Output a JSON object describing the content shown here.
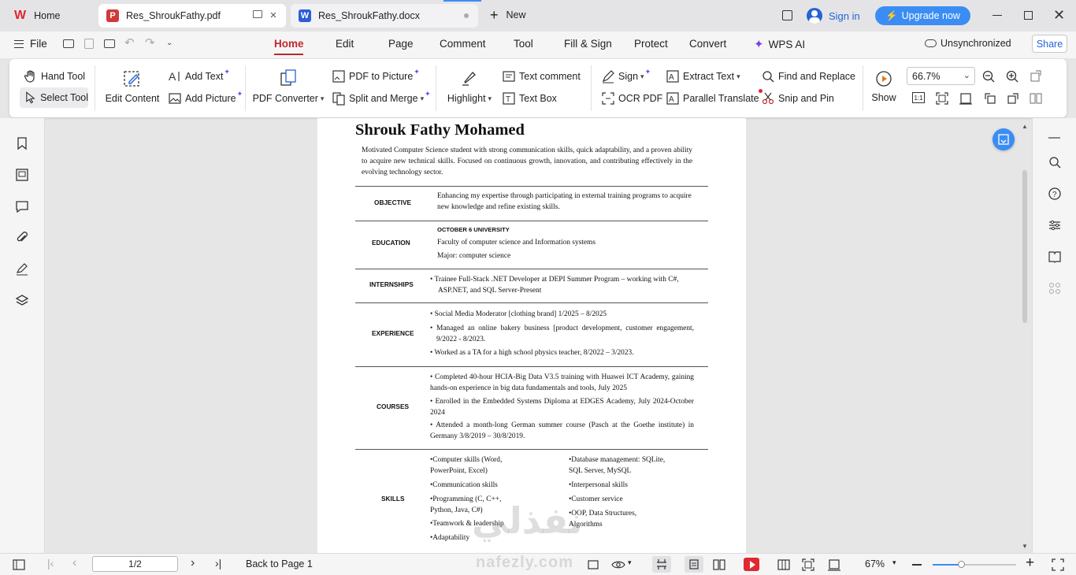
{
  "tabs": [
    {
      "label": "Home",
      "icon": "wps-logo-icon"
    },
    {
      "label": "Res_ShroukFathy.pdf",
      "icon": "pdf-icon"
    },
    {
      "label": "Res_ShroukFathy.docx",
      "icon": "word-icon"
    }
  ],
  "new_tab_label": "New",
  "sign_in_label": "Sign in",
  "upgrade_label": "Upgrade now",
  "menu": {
    "file": "File",
    "tabs": [
      "Home",
      "Edit",
      "Page",
      "Comment",
      "Tool",
      "Fill & Sign",
      "Protect",
      "Convert",
      "WPS AI"
    ],
    "active_tab": "Home",
    "sync_status": "Unsynchronized",
    "share": "Share"
  },
  "ribbon": {
    "hand_tool": "Hand Tool",
    "select_tool": "Select Tool",
    "edit_content": "Edit Content",
    "add_text": "Add Text",
    "add_picture": "Add Picture",
    "pdf_converter": "PDF Converter",
    "pdf_to_picture": "PDF to Picture",
    "split_and_merge": "Split and Merge",
    "highlight": "Highlight",
    "text_comment": "Text comment",
    "text_box": "Text Box",
    "sign": "Sign",
    "ocr_pdf": "OCR PDF",
    "extract_text": "Extract Text",
    "parallel_translate": "Parallel Translate",
    "find_and_replace": "Find and Replace",
    "snip_and_pin": "Snip and Pin",
    "show": "Show",
    "zoom_value": "66.7%",
    "actual_size": "1:1"
  },
  "document": {
    "name": "Shrouk Fathy Mohamed",
    "summary": "Motivated Computer Science student with strong communication skills, quick adaptability, and a proven ability to acquire new technical skills. Focused on continuous growth, innovation, and contributing effectively in the evolving technology sector.",
    "objective_label": "OBJECTIVE",
    "objective": "Enhancing my expertise through participating in external training programs to acquire new knowledge and refine existing skills.",
    "education_label": "EDUCATION",
    "education": {
      "university": "OCTOBER 6 UNIVERSITY",
      "faculty": "Faculty of computer science and Information systems",
      "major": "Major: computer science"
    },
    "internships_label": "INTERNSHIPS",
    "internships": "• Trainee Full-Stack .NET Developer at DEPI Summer Program – working with C#, ASP.NET, and SQL Server-Present",
    "experience_label": "EXPERIENCE",
    "experience": [
      "• Social Media Moderator [clothing brand] 1/2025 – 8/2025",
      "• Managed an online bakery business [product development, customer engagement, 9/2022 - 8/2023.",
      "• Worked as a TA for a high school physics teacher, 8/2022 – 3/2023."
    ],
    "courses_label": "COURSES",
    "courses": [
      "• Completed 40-hour HCIA-Big Data V3.5 training with Huawei ICT Academy, gaining hands-on experience in big data fundamentals and tools, July 2025",
      "• Enrolled in the Embedded Systems Diploma at EDGES Academy, July 2024-October 2024",
      "• Attended a month-long German summer course (Pasch at the Goethe institute) in Germany 3/8/2019 – 30/8/2019."
    ],
    "skills_label": "SKILLS",
    "skills_left": [
      "•Computer skills (Word, PowerPoint, Excel)",
      "•Communication skills",
      "•Programming (C, C++, Python, Java, C#)",
      "•Teamwork & leadership",
      "•Adaptability"
    ],
    "skills_right": [
      "•Database management: SQLite, SQL Server, MySQL",
      "•Interpersonal skills",
      "•Customer service",
      "•OOP, Data Structures, Algorithms"
    ]
  },
  "watermark": {
    "arabic": "نفذلي",
    "latin": "nafezly.com"
  },
  "status": {
    "page_indicator": "1/2",
    "back_to_page": "Back to Page 1",
    "zoom": "67%"
  },
  "colors": {
    "accent": "#c0272d",
    "upgrade_blue": "#3b8df5",
    "sign_in_blue": "#2463d8",
    "pdf_red": "#d03a3a",
    "word_blue": "#2b5fd9"
  }
}
